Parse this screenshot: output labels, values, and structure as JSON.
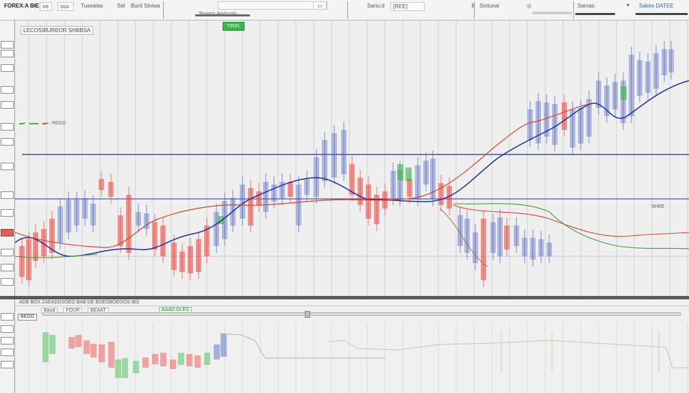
{
  "toolbar": {
    "app_name": "FOREX:A BIE",
    "field_1": "oe",
    "field_2": "ouv",
    "menu_1": "Tuseaias",
    "menu_2": "Sel",
    "menu_3": "Burd Siniwa",
    "symbol_field": "Teumns Avvisunlu",
    "search_value": "",
    "period_1": "Sanu:d",
    "period_2": "[REE]",
    "readout": "Sintunal",
    "right_1": "Samas",
    "right_2": "Sakes DATEE"
  },
  "main": {
    "title": "LECOSIBUREOR SHBBSA",
    "badge": "TIN31",
    "legend_text": "REGD",
    "price_tag": "SHEE",
    "colors": {
      "up": "#4a5fc1",
      "down": "#e8473f",
      "accent_green": "#39b54a",
      "ma_blue": "#1f2c9c",
      "ma_red": "#d8412f",
      "ma_green": "#3f9a37"
    }
  },
  "lower": {
    "header": "ADB BOX ZAEADDSOEO BAB DE BOEOBOEOOS IBS",
    "tab": "BEDO",
    "inputs": [
      "Baud",
      "FOUR",
      "BEAAT"
    ],
    "green_chip": "AAAD GLES"
  },
  "gutter": {
    "labels": [
      "",
      "",
      "",
      "",
      "",
      "",
      "",
      "",
      "",
      "",
      "",
      "",
      "",
      ""
    ]
  }
}
